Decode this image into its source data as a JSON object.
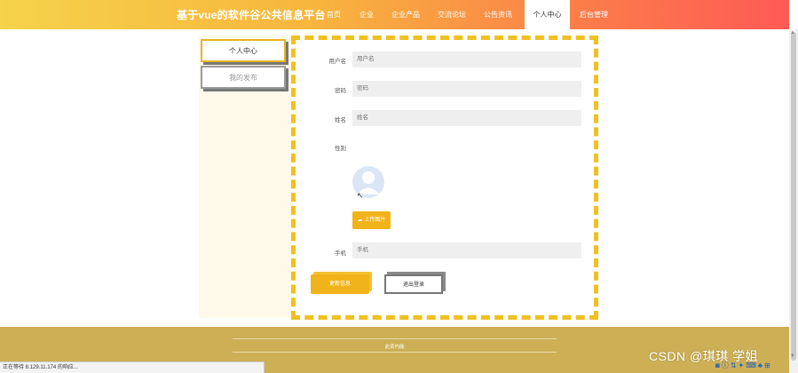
{
  "header": {
    "brand": "基于vue的软件谷公共信息平台",
    "nav": [
      "首页",
      "企业",
      "企业产品",
      "交流论坛",
      "公告资讯",
      "个人中心",
      "后台管理"
    ],
    "active_nav": "个人中心"
  },
  "sidebar": {
    "items": [
      {
        "label": "个人中心"
      },
      {
        "label": "我的发布"
      }
    ]
  },
  "form": {
    "username": {
      "label": "用户名",
      "placeholder": "用户名"
    },
    "password": {
      "label": "密码",
      "placeholder": "密码"
    },
    "name": {
      "label": "姓名",
      "placeholder": "姓名"
    },
    "gender": {
      "label": "性别"
    },
    "upload_label": "上传图片",
    "phone": {
      "label": "手机",
      "placeholder": "手机"
    },
    "save_label": "更新信息",
    "logout_label": "退出登录"
  },
  "footer": {
    "text": "此资内能"
  },
  "status_bar": {
    "text": "正在等待 8.129.11.174 的响应..."
  },
  "watermark": "CSDN @琪琪 学姐",
  "colors": {
    "accent": "#f0b31a",
    "footer": "#cdb055",
    "header_start": "#f6d34a",
    "header_end": "#ff5a55"
  }
}
